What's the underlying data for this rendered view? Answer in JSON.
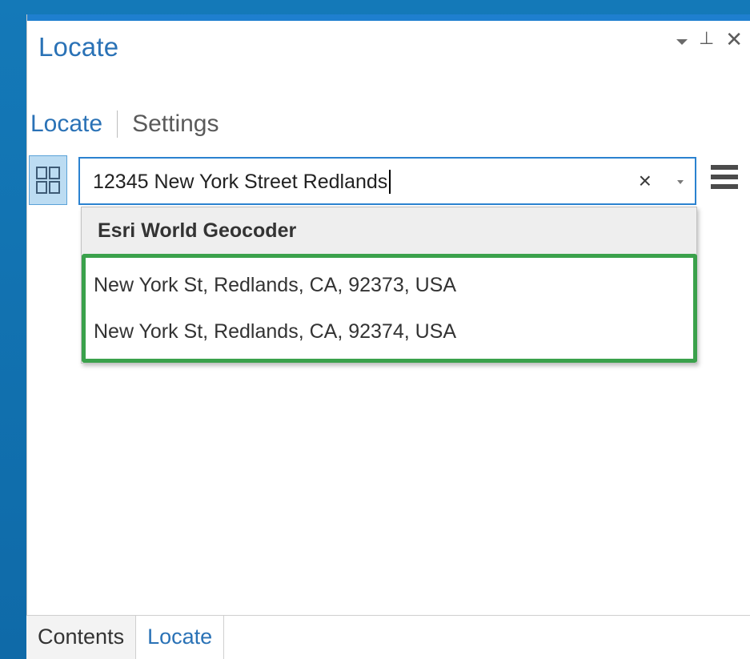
{
  "pane": {
    "title": "Locate",
    "controls": {
      "dropdown_icon": "triangle-down",
      "pin_icon": "pin",
      "close_icon": "close"
    }
  },
  "subtabs": {
    "active": "Locate",
    "inactive": "Settings"
  },
  "search": {
    "value": "12345 New York Street Redlands",
    "clear_symbol": "×"
  },
  "suggestions": {
    "header": "Esri World Geocoder",
    "items": [
      "New York St, Redlands, CA, 92373, USA",
      "New York St, Redlands, CA, 92374, USA"
    ]
  },
  "bottom_tabs": [
    "Contents",
    "Locate"
  ],
  "colors": {
    "accent": "#2a72b6",
    "highlight_border": "#3aa14b",
    "desktop_background": "#1479b8"
  }
}
